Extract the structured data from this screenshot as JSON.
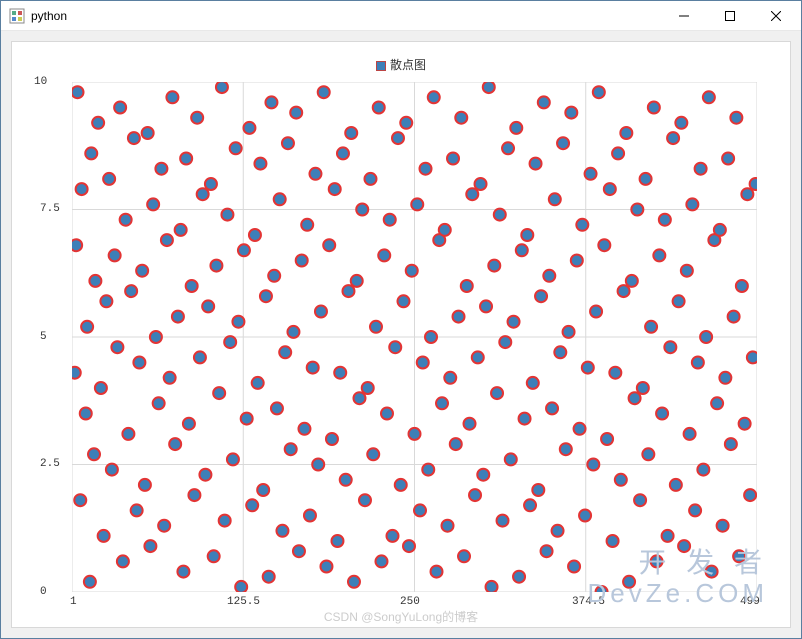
{
  "window": {
    "title": "python"
  },
  "legend": {
    "label": "散点图"
  },
  "watermarks": {
    "line1": "开 发 者",
    "line2": "DevZe.COM",
    "footer": "CSDN @SongYuLong的博客"
  },
  "chart_data": {
    "type": "scatter",
    "title": "",
    "xlabel": "",
    "ylabel": "",
    "xlim": [
      1.0,
      499.0
    ],
    "ylim": [
      0.0,
      10.0
    ],
    "x_ticks": [
      1.0,
      125.5,
      250.0,
      374.5,
      499.0
    ],
    "y_ticks": [
      0.0,
      2.5,
      5.0,
      7.5,
      10.0
    ],
    "legend": [
      "散点图"
    ],
    "marker": {
      "fill": "#3d7fb8",
      "edge": "#e33434",
      "size": 6
    },
    "series": [
      {
        "name": "散点图",
        "points": [
          [
            3,
            4.3
          ],
          [
            4,
            6.8
          ],
          [
            5,
            9.8
          ],
          [
            7,
            1.8
          ],
          [
            8,
            7.9
          ],
          [
            11,
            3.5
          ],
          [
            12,
            5.2
          ],
          [
            14,
            0.2
          ],
          [
            15,
            8.6
          ],
          [
            17,
            2.7
          ],
          [
            18,
            6.1
          ],
          [
            20,
            9.2
          ],
          [
            22,
            4.0
          ],
          [
            24,
            1.1
          ],
          [
            26,
            5.7
          ],
          [
            28,
            8.1
          ],
          [
            30,
            2.4
          ],
          [
            32,
            6.6
          ],
          [
            34,
            4.8
          ],
          [
            36,
            9.5
          ],
          [
            38,
            0.6
          ],
          [
            40,
            7.3
          ],
          [
            42,
            3.1
          ],
          [
            44,
            5.9
          ],
          [
            46,
            8.9
          ],
          [
            48,
            1.6
          ],
          [
            50,
            4.5
          ],
          [
            52,
            6.3
          ],
          [
            54,
            2.1
          ],
          [
            56,
            9.0
          ],
          [
            58,
            0.9
          ],
          [
            60,
            7.6
          ],
          [
            62,
            5.0
          ],
          [
            64,
            3.7
          ],
          [
            66,
            8.3
          ],
          [
            68,
            1.3
          ],
          [
            70,
            6.9
          ],
          [
            72,
            4.2
          ],
          [
            74,
            9.7
          ],
          [
            76,
            2.9
          ],
          [
            78,
            5.4
          ],
          [
            80,
            7.1
          ],
          [
            82,
            0.4
          ],
          [
            84,
            8.5
          ],
          [
            86,
            3.3
          ],
          [
            88,
            6.0
          ],
          [
            90,
            1.9
          ],
          [
            92,
            9.3
          ],
          [
            94,
            4.6
          ],
          [
            96,
            7.8
          ],
          [
            98,
            2.3
          ],
          [
            100,
            5.6
          ],
          [
            102,
            8.0
          ],
          [
            104,
            0.7
          ],
          [
            106,
            6.4
          ],
          [
            108,
            3.9
          ],
          [
            110,
            9.9
          ],
          [
            112,
            1.4
          ],
          [
            114,
            7.4
          ],
          [
            116,
            4.9
          ],
          [
            118,
            2.6
          ],
          [
            120,
            8.7
          ],
          [
            122,
            5.3
          ],
          [
            124,
            0.1
          ],
          [
            126,
            6.7
          ],
          [
            128,
            3.4
          ],
          [
            130,
            9.1
          ],
          [
            132,
            1.7
          ],
          [
            134,
            7.0
          ],
          [
            136,
            4.1
          ],
          [
            138,
            8.4
          ],
          [
            140,
            2.0
          ],
          [
            142,
            5.8
          ],
          [
            144,
            0.3
          ],
          [
            146,
            9.6
          ],
          [
            148,
            6.2
          ],
          [
            150,
            3.6
          ],
          [
            152,
            7.7
          ],
          [
            154,
            1.2
          ],
          [
            156,
            4.7
          ],
          [
            158,
            8.8
          ],
          [
            160,
            2.8
          ],
          [
            162,
            5.1
          ],
          [
            164,
            9.4
          ],
          [
            166,
            0.8
          ],
          [
            168,
            6.5
          ],
          [
            170,
            3.2
          ],
          [
            172,
            7.2
          ],
          [
            174,
            1.5
          ],
          [
            176,
            4.4
          ],
          [
            178,
            8.2
          ],
          [
            180,
            2.5
          ],
          [
            182,
            5.5
          ],
          [
            184,
            9.8
          ],
          [
            186,
            0.5
          ],
          [
            188,
            6.8
          ],
          [
            190,
            3.0
          ],
          [
            192,
            7.9
          ],
          [
            194,
            1.0
          ],
          [
            196,
            4.3
          ],
          [
            198,
            8.6
          ],
          [
            200,
            2.2
          ],
          [
            202,
            5.9
          ],
          [
            204,
            9.0
          ],
          [
            206,
            0.2
          ],
          [
            208,
            6.1
          ],
          [
            210,
            3.8
          ],
          [
            212,
            7.5
          ],
          [
            214,
            1.8
          ],
          [
            216,
            4.0
          ],
          [
            218,
            8.1
          ],
          [
            220,
            2.7
          ],
          [
            222,
            5.2
          ],
          [
            224,
            9.5
          ],
          [
            226,
            0.6
          ],
          [
            228,
            6.6
          ],
          [
            230,
            3.5
          ],
          [
            232,
            7.3
          ],
          [
            234,
            1.1
          ],
          [
            236,
            4.8
          ],
          [
            238,
            8.9
          ],
          [
            240,
            2.1
          ],
          [
            242,
            5.7
          ],
          [
            244,
            9.2
          ],
          [
            246,
            0.9
          ],
          [
            248,
            6.3
          ],
          [
            250,
            3.1
          ],
          [
            252,
            7.6
          ],
          [
            254,
            1.6
          ],
          [
            256,
            4.5
          ],
          [
            258,
            8.3
          ],
          [
            260,
            2.4
          ],
          [
            262,
            5.0
          ],
          [
            264,
            9.7
          ],
          [
            266,
            0.4
          ],
          [
            268,
            6.9
          ],
          [
            270,
            3.7
          ],
          [
            272,
            7.1
          ],
          [
            274,
            1.3
          ],
          [
            276,
            4.2
          ],
          [
            278,
            8.5
          ],
          [
            280,
            2.9
          ],
          [
            282,
            5.4
          ],
          [
            284,
            9.3
          ],
          [
            286,
            0.7
          ],
          [
            288,
            6.0
          ],
          [
            290,
            3.3
          ],
          [
            292,
            7.8
          ],
          [
            294,
            1.9
          ],
          [
            296,
            4.6
          ],
          [
            298,
            8.0
          ],
          [
            300,
            2.3
          ],
          [
            302,
            5.6
          ],
          [
            304,
            9.9
          ],
          [
            306,
            0.1
          ],
          [
            308,
            6.4
          ],
          [
            310,
            3.9
          ],
          [
            312,
            7.4
          ],
          [
            314,
            1.4
          ],
          [
            316,
            4.9
          ],
          [
            318,
            8.7
          ],
          [
            320,
            2.6
          ],
          [
            322,
            5.3
          ],
          [
            324,
            9.1
          ],
          [
            326,
            0.3
          ],
          [
            328,
            6.7
          ],
          [
            330,
            3.4
          ],
          [
            332,
            7.0
          ],
          [
            334,
            1.7
          ],
          [
            336,
            4.1
          ],
          [
            338,
            8.4
          ],
          [
            340,
            2.0
          ],
          [
            342,
            5.8
          ],
          [
            344,
            9.6
          ],
          [
            346,
            0.8
          ],
          [
            348,
            6.2
          ],
          [
            350,
            3.6
          ],
          [
            352,
            7.7
          ],
          [
            354,
            1.2
          ],
          [
            356,
            4.7
          ],
          [
            358,
            8.8
          ],
          [
            360,
            2.8
          ],
          [
            362,
            5.1
          ],
          [
            364,
            9.4
          ],
          [
            366,
            0.5
          ],
          [
            368,
            6.5
          ],
          [
            370,
            3.2
          ],
          [
            372,
            7.2
          ],
          [
            374,
            1.5
          ],
          [
            376,
            4.4
          ],
          [
            378,
            8.2
          ],
          [
            380,
            2.5
          ],
          [
            382,
            5.5
          ],
          [
            384,
            9.8
          ],
          [
            386,
            0.0
          ],
          [
            388,
            6.8
          ],
          [
            390,
            3.0
          ],
          [
            392,
            7.9
          ],
          [
            394,
            1.0
          ],
          [
            396,
            4.3
          ],
          [
            398,
            8.6
          ],
          [
            400,
            2.2
          ],
          [
            402,
            5.9
          ],
          [
            404,
            9.0
          ],
          [
            406,
            0.2
          ],
          [
            408,
            6.1
          ],
          [
            410,
            3.8
          ],
          [
            412,
            7.5
          ],
          [
            414,
            1.8
          ],
          [
            416,
            4.0
          ],
          [
            418,
            8.1
          ],
          [
            420,
            2.7
          ],
          [
            422,
            5.2
          ],
          [
            424,
            9.5
          ],
          [
            426,
            0.6
          ],
          [
            428,
            6.6
          ],
          [
            430,
            3.5
          ],
          [
            432,
            7.3
          ],
          [
            434,
            1.1
          ],
          [
            436,
            4.8
          ],
          [
            438,
            8.9
          ],
          [
            440,
            2.1
          ],
          [
            442,
            5.7
          ],
          [
            444,
            9.2
          ],
          [
            446,
            0.9
          ],
          [
            448,
            6.3
          ],
          [
            450,
            3.1
          ],
          [
            452,
            7.6
          ],
          [
            454,
            1.6
          ],
          [
            456,
            4.5
          ],
          [
            458,
            8.3
          ],
          [
            460,
            2.4
          ],
          [
            462,
            5.0
          ],
          [
            464,
            9.7
          ],
          [
            466,
            0.4
          ],
          [
            468,
            6.9
          ],
          [
            470,
            3.7
          ],
          [
            472,
            7.1
          ],
          [
            474,
            1.3
          ],
          [
            476,
            4.2
          ],
          [
            478,
            8.5
          ],
          [
            480,
            2.9
          ],
          [
            482,
            5.4
          ],
          [
            484,
            9.3
          ],
          [
            486,
            0.7
          ],
          [
            488,
            6.0
          ],
          [
            490,
            3.3
          ],
          [
            492,
            7.8
          ],
          [
            494,
            1.9
          ],
          [
            496,
            4.6
          ],
          [
            498,
            8.0
          ]
        ]
      }
    ]
  }
}
